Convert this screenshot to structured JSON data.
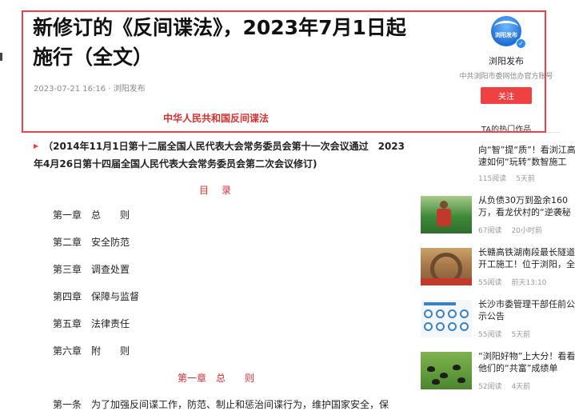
{
  "article": {
    "title": "新修订的《反间谍法》，2023年7月1日起施行（全文）",
    "meta": "2023-07-21 16:16 · 浏阳发布",
    "law_name": "中华人民共和国反间谍法",
    "preface": "（2014年11月1日第十二届全国人民代表大会常务委员会第十一次会议通过　2023年4月26日第十四届全国人民代表大会常务委员会第二次会议修订)",
    "toc_title": "目　录",
    "toc": [
      "第一章　总　　则",
      "第二章　安全防范",
      "第三章　调查处置",
      "第四章　保障与监督",
      "第五章　法律责任",
      "第六章　附　　则"
    ],
    "chapter_heading": "第一章　总　　则",
    "first_line": "第一条　为了加强反间谍工作，防范、制止和惩治间谍行为，维护国家安全，保"
  },
  "author": {
    "avatar_text": "浏阳发布",
    "name": "浏阳发布",
    "description": "中共浏阳市委网信办官方账号",
    "follow_label": "关注",
    "verified_glyph": "✓",
    "avatar_color": "#1f6fd6"
  },
  "hot": {
    "header": "TA的热门作品",
    "items": [
      {
        "title": "向“智”提“质”！看浏江高速如何“玩转”数智施工",
        "reads": "115阅读",
        "time": "5天前"
      },
      {
        "title": "从负债30万到盈余160万，看龙伏村的“逆袭秘籍”",
        "reads": "67阅读",
        "time": "20小时前"
      },
      {
        "title": "长赣高铁湖南段最长隧道开工施工！位于浏阳，全长逾",
        "reads": "55阅读",
        "time": "前天13:10"
      },
      {
        "title": "长沙市委管理干部任前公示公告",
        "reads": "55阅读",
        "time": "5天前"
      },
      {
        "title": "“浏阳好物”上大分！看看他们的“共富”成绩单",
        "reads": "52阅读",
        "time": "4天前"
      }
    ]
  },
  "colors": {
    "accent_red": "#e8424a",
    "follow_button": "#f04142",
    "section_red": "#d62f2f"
  }
}
